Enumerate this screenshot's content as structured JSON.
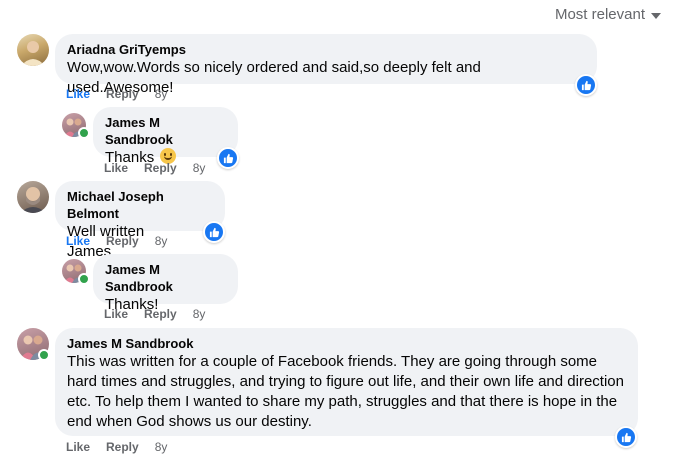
{
  "header": {
    "sort_label": "Most relevant"
  },
  "comments": [
    {
      "author": "Ariadna GriTyemps",
      "text": "Wow,wow.Words so nicely ordered and said,so deeply felt and used.Awesome!",
      "actions": {
        "like": "Like",
        "reply": "Reply",
        "time": "8y"
      },
      "reaction": "like-reaction-icon"
    },
    {
      "author": "James M Sandbrook",
      "text": "Thanks",
      "emoji": "smile-emoji",
      "actions": {
        "like": "Like",
        "reply": "Reply",
        "time": "8y"
      },
      "reaction": "like-reaction-icon"
    },
    {
      "author": "Michael Joseph Belmont",
      "text": "Well written James......",
      "actions": {
        "like": "Like",
        "reply": "Reply",
        "time": "8y"
      },
      "reaction": "like-reaction-icon"
    },
    {
      "author": "James M Sandbrook",
      "text": "Thanks!",
      "actions": {
        "like": "Like",
        "reply": "Reply",
        "time": "8y"
      }
    },
    {
      "author": "James M Sandbrook",
      "text": "This was written for a couple of Facebook friends. They are going through some hard times and struggles, and trying to figure out life, and their own life and direction etc. To help them I wanted to share my path, struggles and that there is hope in the end when God shows us our destiny.",
      "actions": {
        "like": "Like",
        "reply": "Reply",
        "time": "8y"
      },
      "reaction": "like-reaction-icon"
    }
  ],
  "colors": {
    "accent": "#1877f2",
    "bubble": "#f0f2f5",
    "muted": "#65676b",
    "online": "#31a24c"
  }
}
